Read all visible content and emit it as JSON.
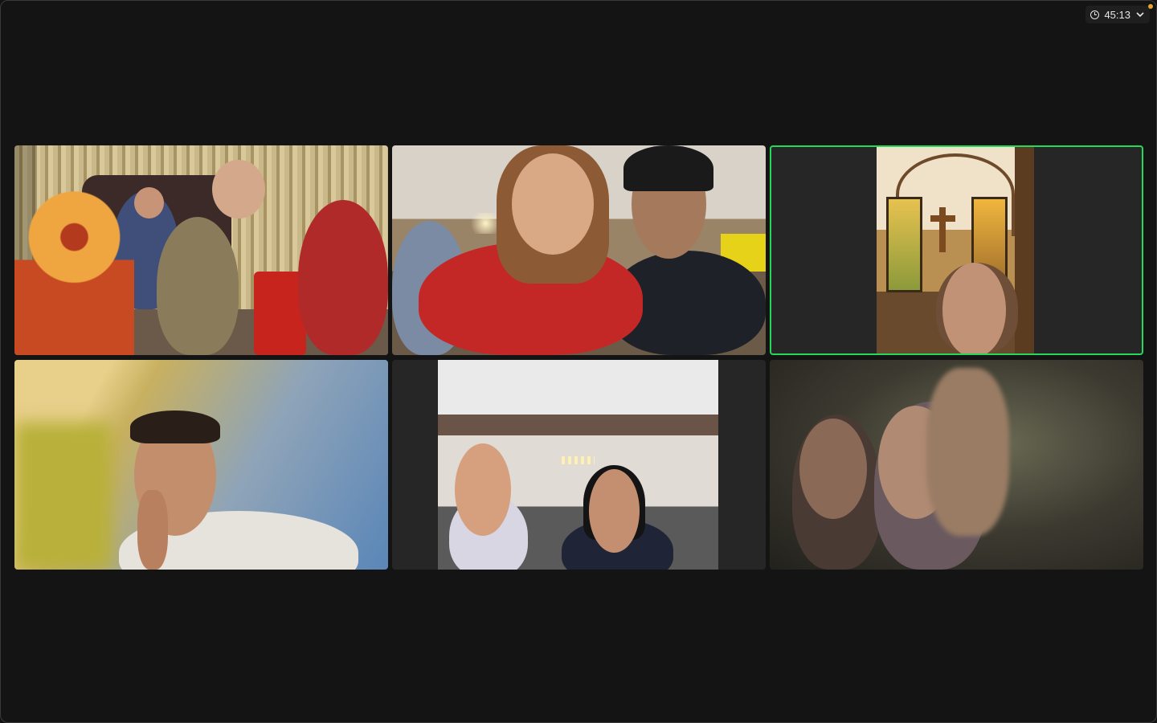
{
  "meeting": {
    "timer": "45:13",
    "timer_icon": "clock-icon",
    "menu_icon": "chevron-down-icon",
    "recording_indicator_color": "#e8a42a"
  },
  "gallery": {
    "active_speaker_color": "#23d959",
    "tiles": [
      {
        "id": "participant-1"
      },
      {
        "id": "participant-2"
      },
      {
        "id": "participant-3",
        "active": true
      },
      {
        "id": "participant-4"
      },
      {
        "id": "participant-5"
      },
      {
        "id": "participant-6"
      }
    ]
  }
}
